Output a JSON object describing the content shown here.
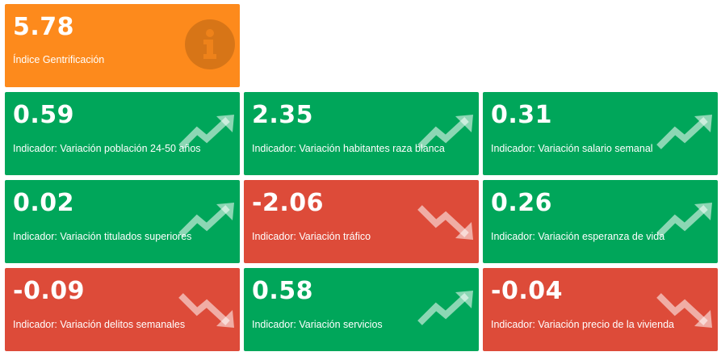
{
  "colors": {
    "orange": "#fd8a1c",
    "green": "#00a65a",
    "red": "#dd4b39"
  },
  "header_box": {
    "value": "5.78",
    "label": "Índice Gentrificación",
    "icon": "info-icon",
    "color": "orange"
  },
  "indicators": [
    {
      "value": "0.59",
      "label": "Indicador: Variación población 24-50 años",
      "trend": "up",
      "icon": "trend-up-icon"
    },
    {
      "value": "2.35",
      "label": "Indicador: Variación habitantes raza blanca",
      "trend": "up",
      "icon": "trend-up-icon"
    },
    {
      "value": "0.31",
      "label": "Indicador: Variación salario semanal",
      "trend": "up",
      "icon": "trend-up-icon"
    },
    {
      "value": "0.02",
      "label": "Indicador: Variación titulados superiores",
      "trend": "up",
      "icon": "trend-up-icon"
    },
    {
      "value": "-2.06",
      "label": "Indicador: Variación tráfico",
      "trend": "down",
      "icon": "trend-down-icon"
    },
    {
      "value": "0.26",
      "label": "Indicador: Variación esperanza de vida",
      "trend": "up",
      "icon": "trend-up-icon"
    },
    {
      "value": "-0.09",
      "label": "Indicador: Variación delitos semanales",
      "trend": "down",
      "icon": "trend-down-icon"
    },
    {
      "value": "0.58",
      "label": "Indicador: Variación servicios",
      "trend": "up",
      "icon": "trend-up-icon"
    },
    {
      "value": "-0.04",
      "label": "Indicador: Variación precio de la vivienda",
      "trend": "down",
      "icon": "trend-down-icon"
    }
  ]
}
